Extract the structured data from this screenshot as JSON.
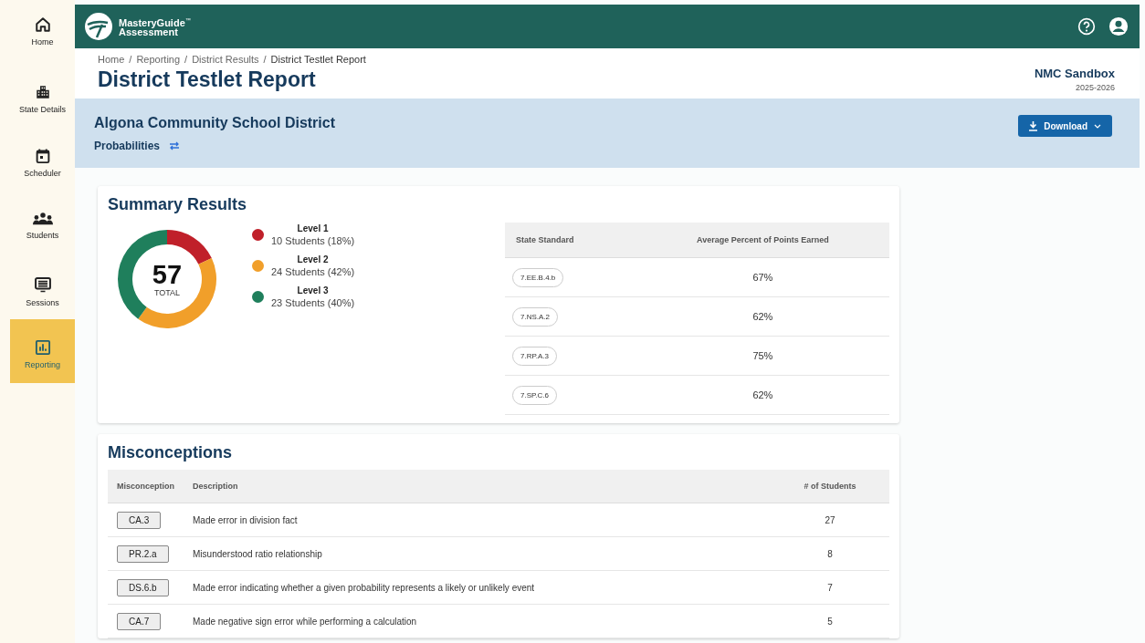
{
  "sidebar": {
    "items": [
      {
        "label": "Home",
        "selected": false
      },
      {
        "label": "State Details",
        "selected": false
      },
      {
        "label": "Scheduler",
        "selected": false
      },
      {
        "label": "Students",
        "selected": false
      },
      {
        "label": "Sessions",
        "selected": false
      },
      {
        "label": "Reporting",
        "selected": true
      }
    ]
  },
  "header": {
    "logo_line_1": "MasteryGuide",
    "logo_mark": "™",
    "logo_line_2": "Assessment"
  },
  "breadcrumbs": [
    "Home",
    "Reporting",
    "District Results",
    "District Testlet Report"
  ],
  "breadcrumb_separator": "/",
  "page_title": "District Testlet Report",
  "org": {
    "name": "NMC Sandbox",
    "year": "2025-2026"
  },
  "district": {
    "name": "Algona Community School District",
    "subject": "Probabilities",
    "download_label": "Download"
  },
  "summary": {
    "title": "Summary Results",
    "total": "57",
    "total_label": "TOTAL",
    "legend": [
      {
        "detail": "10 Students (18%)",
        "color": "#c0202a"
      },
      {
        "detail": "24 Students (42%)",
        "color": "#f19f2a"
      },
      {
        "detail": "23 Students (40%)",
        "color": "#1f7f5c"
      }
    ],
    "chart_data": {
      "type": "donut",
      "categories": [
        "Level 1",
        "Level 2",
        "Level 3"
      ],
      "values": [
        18,
        42,
        40
      ]
    },
    "standards": {
      "columns": [
        "State Standard",
        "Average Percent of Points Earned"
      ],
      "rows": [
        {
          "standard": "7.EE.B.4.b",
          "percent": "67%"
        },
        {
          "standard": "7.NS.A.2",
          "percent": "62%"
        },
        {
          "standard": "7.RP.A.3",
          "percent": "75%"
        },
        {
          "standard": "7.SP.C.6",
          "percent": "62%"
        }
      ]
    }
  },
  "misconceptions": {
    "title": "Misconceptions",
    "columns": [
      "Misconception",
      "Description",
      "# of Students"
    ],
    "rows": [
      {
        "code": "CA.3",
        "description": "Made error in division fact",
        "students": "27"
      },
      {
        "code": "PR.2.a",
        "description": "Misunderstood ratio relationship",
        "students": "8"
      },
      {
        "code": "DS.6.b",
        "description": "Made error indicating whether a given probability represents a likely or unlikely event",
        "students": "7"
      },
      {
        "code": "CA.7",
        "description": "Made negative sign error while performing a calculation",
        "students": "5"
      }
    ]
  }
}
